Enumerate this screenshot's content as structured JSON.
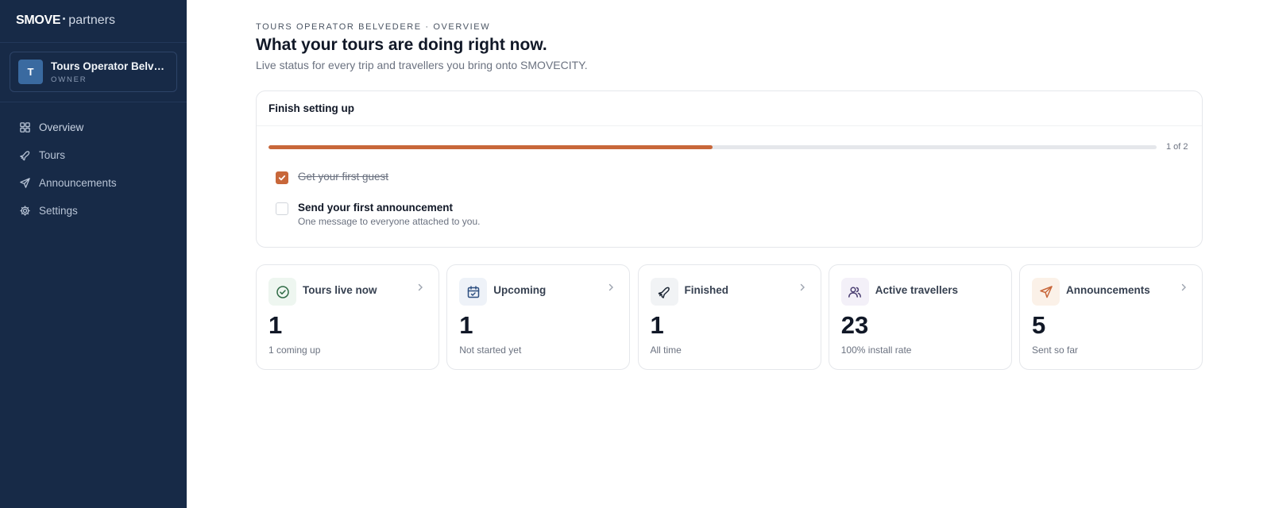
{
  "brand": {
    "name": "SMOVE",
    "suffix": "partners"
  },
  "account": {
    "initial": "T",
    "name": "Tours Operator Belvedere",
    "role": "OWNER"
  },
  "nav": [
    {
      "label": "Overview",
      "icon": "grid-icon"
    },
    {
      "label": "Tours",
      "icon": "plane-icon"
    },
    {
      "label": "Announcements",
      "icon": "send-icon"
    },
    {
      "label": "Settings",
      "icon": "gear-icon"
    }
  ],
  "header": {
    "eyebrow": "TOURS OPERATOR BELVEDERE · OVERVIEW",
    "title": "What your tours are doing right now.",
    "subtitle": "Live status for every trip and travellers you bring onto SMOVECITY."
  },
  "setup": {
    "title": "Finish setting up",
    "progress_label": "1 of 2",
    "progress_fraction": 0.5,
    "tasks": [
      {
        "title": "Get your first guest",
        "done": true,
        "description": ""
      },
      {
        "title": "Send your first announcement",
        "done": false,
        "description": "One message to everyone attached to you."
      }
    ]
  },
  "stats": [
    {
      "label": "Tours live now",
      "value": "1",
      "sub": "1 coming up",
      "icon": "check-circle-icon",
      "icon_bg": "#eef6f0",
      "icon_color": "#2f6b45"
    },
    {
      "label": "Upcoming",
      "value": "1",
      "sub": "Not started yet",
      "icon": "calendar-icon",
      "icon_bg": "#eef2f8",
      "icon_color": "#2d4f80"
    },
    {
      "label": "Finished",
      "value": "1",
      "sub": "All time",
      "icon": "plane-icon",
      "icon_bg": "#f1f3f5",
      "icon_color": "#1f2937"
    },
    {
      "label": "Active travellers",
      "value": "23",
      "sub": "100% install rate",
      "icon": "users-icon",
      "icon_bg": "#f3f0f8",
      "icon_color": "#4b3f72"
    },
    {
      "label": "Announcements",
      "value": "5",
      "sub": "Sent so far",
      "icon": "send-icon",
      "icon_bg": "#fbf1e8",
      "icon_color": "#c8673a"
    }
  ],
  "colors": {
    "sidebar": "#172a47",
    "accent": "#c8673a"
  }
}
